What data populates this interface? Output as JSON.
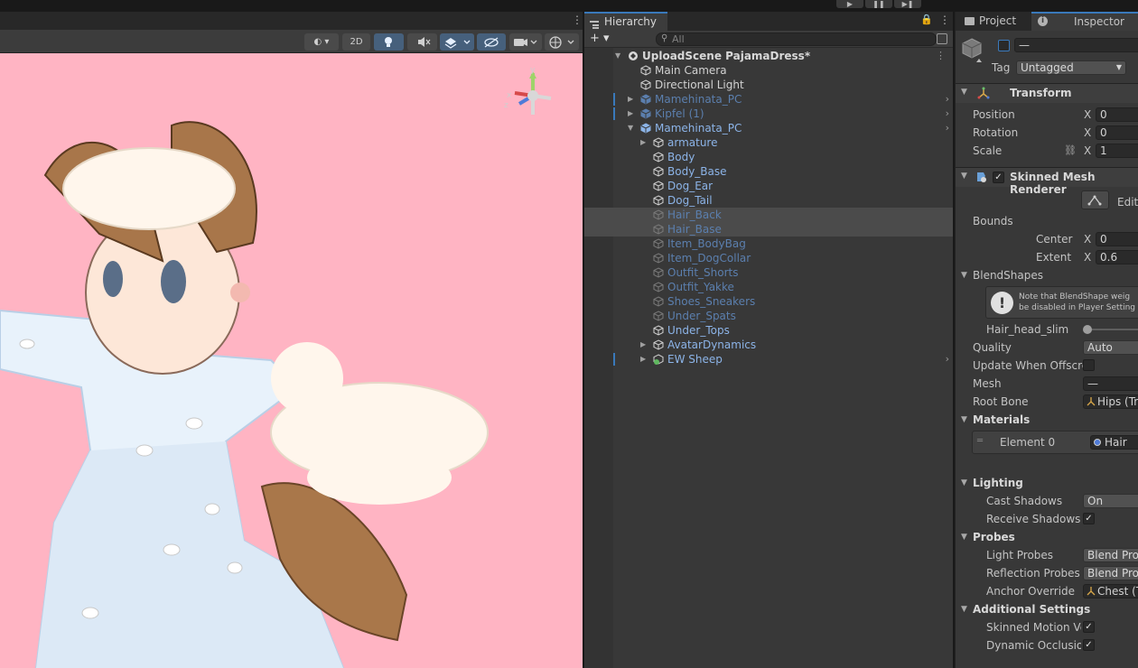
{
  "toolbar": {
    "play": "▶",
    "pause": "❚❚",
    "step": "▶❚"
  },
  "scene": {
    "menu_icon": "kebab-menu-icon",
    "tools": {
      "shading": "◐ ▾",
      "mode_2d": "2D",
      "lighting": "💡",
      "audio": "🔇",
      "effects": "◈ ▾",
      "hidden": "⊘",
      "camera": "■ ▾",
      "gizmos": "⊕ ▾"
    },
    "gizmo": {
      "y": "y",
      "z": "z",
      "x": "x"
    }
  },
  "hierarchy": {
    "tab_label": "Hierarchy",
    "add_label": "+ ▾",
    "search_placeholder": "All",
    "items": [
      {
        "label": "UploadScene PajamaDress*",
        "kind": "scene"
      },
      {
        "label": "Main Camera",
        "kind": "go"
      },
      {
        "label": "Directional Light",
        "kind": "go"
      },
      {
        "label": "Mamehinata_PC",
        "kind": "prefab-dim"
      },
      {
        "label": "Kipfel (1)",
        "kind": "prefab-dim"
      },
      {
        "label": "Mamehinata_PC",
        "kind": "prefab"
      },
      {
        "label": "armature",
        "kind": "child"
      },
      {
        "label": "Body",
        "kind": "child"
      },
      {
        "label": "Body_Base",
        "kind": "child"
      },
      {
        "label": "Dog_Ear",
        "kind": "child"
      },
      {
        "label": "Dog_Tail",
        "kind": "child"
      },
      {
        "label": "Hair_Back",
        "kind": "child-dim"
      },
      {
        "label": "Hair_Base",
        "kind": "child-dim"
      },
      {
        "label": "Item_BodyBag",
        "kind": "child-dim"
      },
      {
        "label": "Item_DogCollar",
        "kind": "child-dim"
      },
      {
        "label": "Outfit_Shorts",
        "kind": "child-dim"
      },
      {
        "label": "Outfit_Yakke",
        "kind": "child-dim"
      },
      {
        "label": "Shoes_Sneakers",
        "kind": "child-dim"
      },
      {
        "label": "Under_Spats",
        "kind": "child-dim"
      },
      {
        "label": "Under_Tops",
        "kind": "child"
      },
      {
        "label": "AvatarDynamics",
        "kind": "child"
      },
      {
        "label": "EW Sheep",
        "kind": "child"
      }
    ]
  },
  "inspector": {
    "tabs": {
      "project": "Project",
      "inspector": "Inspector"
    },
    "object_name": "—",
    "tag_label": "Tag",
    "tag_value": "Untagged",
    "transform": {
      "title": "Transform",
      "position_label": "Position",
      "position_x": "0",
      "rotation_label": "Rotation",
      "rotation_x": "0",
      "scale_label": "Scale",
      "scale_x": "1",
      "x_axis": "X"
    },
    "smr": {
      "title": "Skinned Mesh Renderer",
      "edit_label": "Edit",
      "bounds_label": "Bounds",
      "center_label": "Center",
      "center_x": "0",
      "extent_label": "Extent",
      "extent_x": "0.6",
      "blendshapes_label": "BlendShapes",
      "blendshape_note": "Note that BlendShape weig be disabled in Player Setting",
      "blendshape_name": "Hair_head_slim",
      "quality_label": "Quality",
      "quality_value": "Auto",
      "update_offscreen_label": "Update When Offscre",
      "mesh_label": "Mesh",
      "mesh_value": "—",
      "root_bone_label": "Root Bone",
      "root_bone_value": "Hips (Tra",
      "materials_label": "Materials",
      "element0_label": "Element 0",
      "element0_value": "Hair",
      "lighting_label": "Lighting",
      "cast_shadows_label": "Cast Shadows",
      "cast_shadows_value": "On",
      "receive_shadows_label": "Receive Shadows",
      "probes_label": "Probes",
      "light_probes_label": "Light Probes",
      "light_probes_value": "Blend Prob",
      "reflection_probes_label": "Reflection Probes",
      "reflection_probes_value": "Blend Prob",
      "anchor_override_label": "Anchor Override",
      "anchor_override_value": "Chest (T",
      "additional_label": "Additional Settings",
      "skinned_motion_label": "Skinned Motion Ve",
      "dynamic_occlusion_label": "Dynamic Occlusion"
    },
    "check": "✓"
  }
}
